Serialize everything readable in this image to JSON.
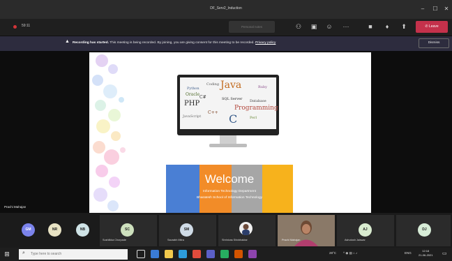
{
  "window": {
    "title": "DF_Serv2_Induction"
  },
  "toolbar": {
    "timer": "59:11",
    "notes_label": "Personal notes",
    "leave_label": "Leave"
  },
  "banner": {
    "bold": "Recording has started.",
    "text": "This meeting is being recorded. By joining, you are giving consent for this meeting to be recorded.",
    "link": "Privacy policy",
    "dismiss_label": "Dismiss"
  },
  "presenter": {
    "name": "Prachi Mahajan"
  },
  "slide": {
    "welcome_title": "Welcome",
    "subtitle1": "Information Technology Department",
    "subtitle2": "Bharatesh School of Information Technology",
    "word_cloud": [
      "Java",
      "PHP",
      "SQL Server",
      "Programming",
      "Oracle",
      "Database",
      "Python",
      "C++",
      "C#",
      "JavaScript",
      "Perl",
      "Ruby",
      "Coding",
      "C"
    ]
  },
  "participants": [
    {
      "initials": "GM",
      "name": "",
      "color": "#7b83eb"
    },
    {
      "initials": "NR",
      "name": "",
      "color": "#e8e3c4"
    },
    {
      "initials": "NB",
      "name": "",
      "color": "#cfe3e6"
    },
    {
      "initials": "SC",
      "name": "Sushilkka Chorpade",
      "color": "#cde0bd"
    },
    {
      "initials": "SM",
      "name": "Saurabh Mitra",
      "color": "#cfdbe6"
    },
    {
      "initials": "",
      "name": "Shrinivas Shivbhaktar",
      "color": "#ffffff"
    },
    {
      "initials": "",
      "name": "Prachi Mahajan",
      "color": "#8a7060"
    },
    {
      "initials": "AJ",
      "name": "Ashutosh Jaiswar",
      "color": "#d9ecd0"
    },
    {
      "initials": "DJ",
      "name": "",
      "color": "#d7ecd7"
    }
  ],
  "taskbar": {
    "search_placeholder": "Type here to search",
    "weather": "28°C",
    "lang": "ENG",
    "time": "12:18",
    "date": "21-06-2021"
  },
  "colors": {
    "leave": "#c4314b",
    "band_blue": "#4a7fd4",
    "band_orange": "#f28c28",
    "band_gray": "#a6a6a6",
    "band_yellow": "#f7b21c"
  }
}
